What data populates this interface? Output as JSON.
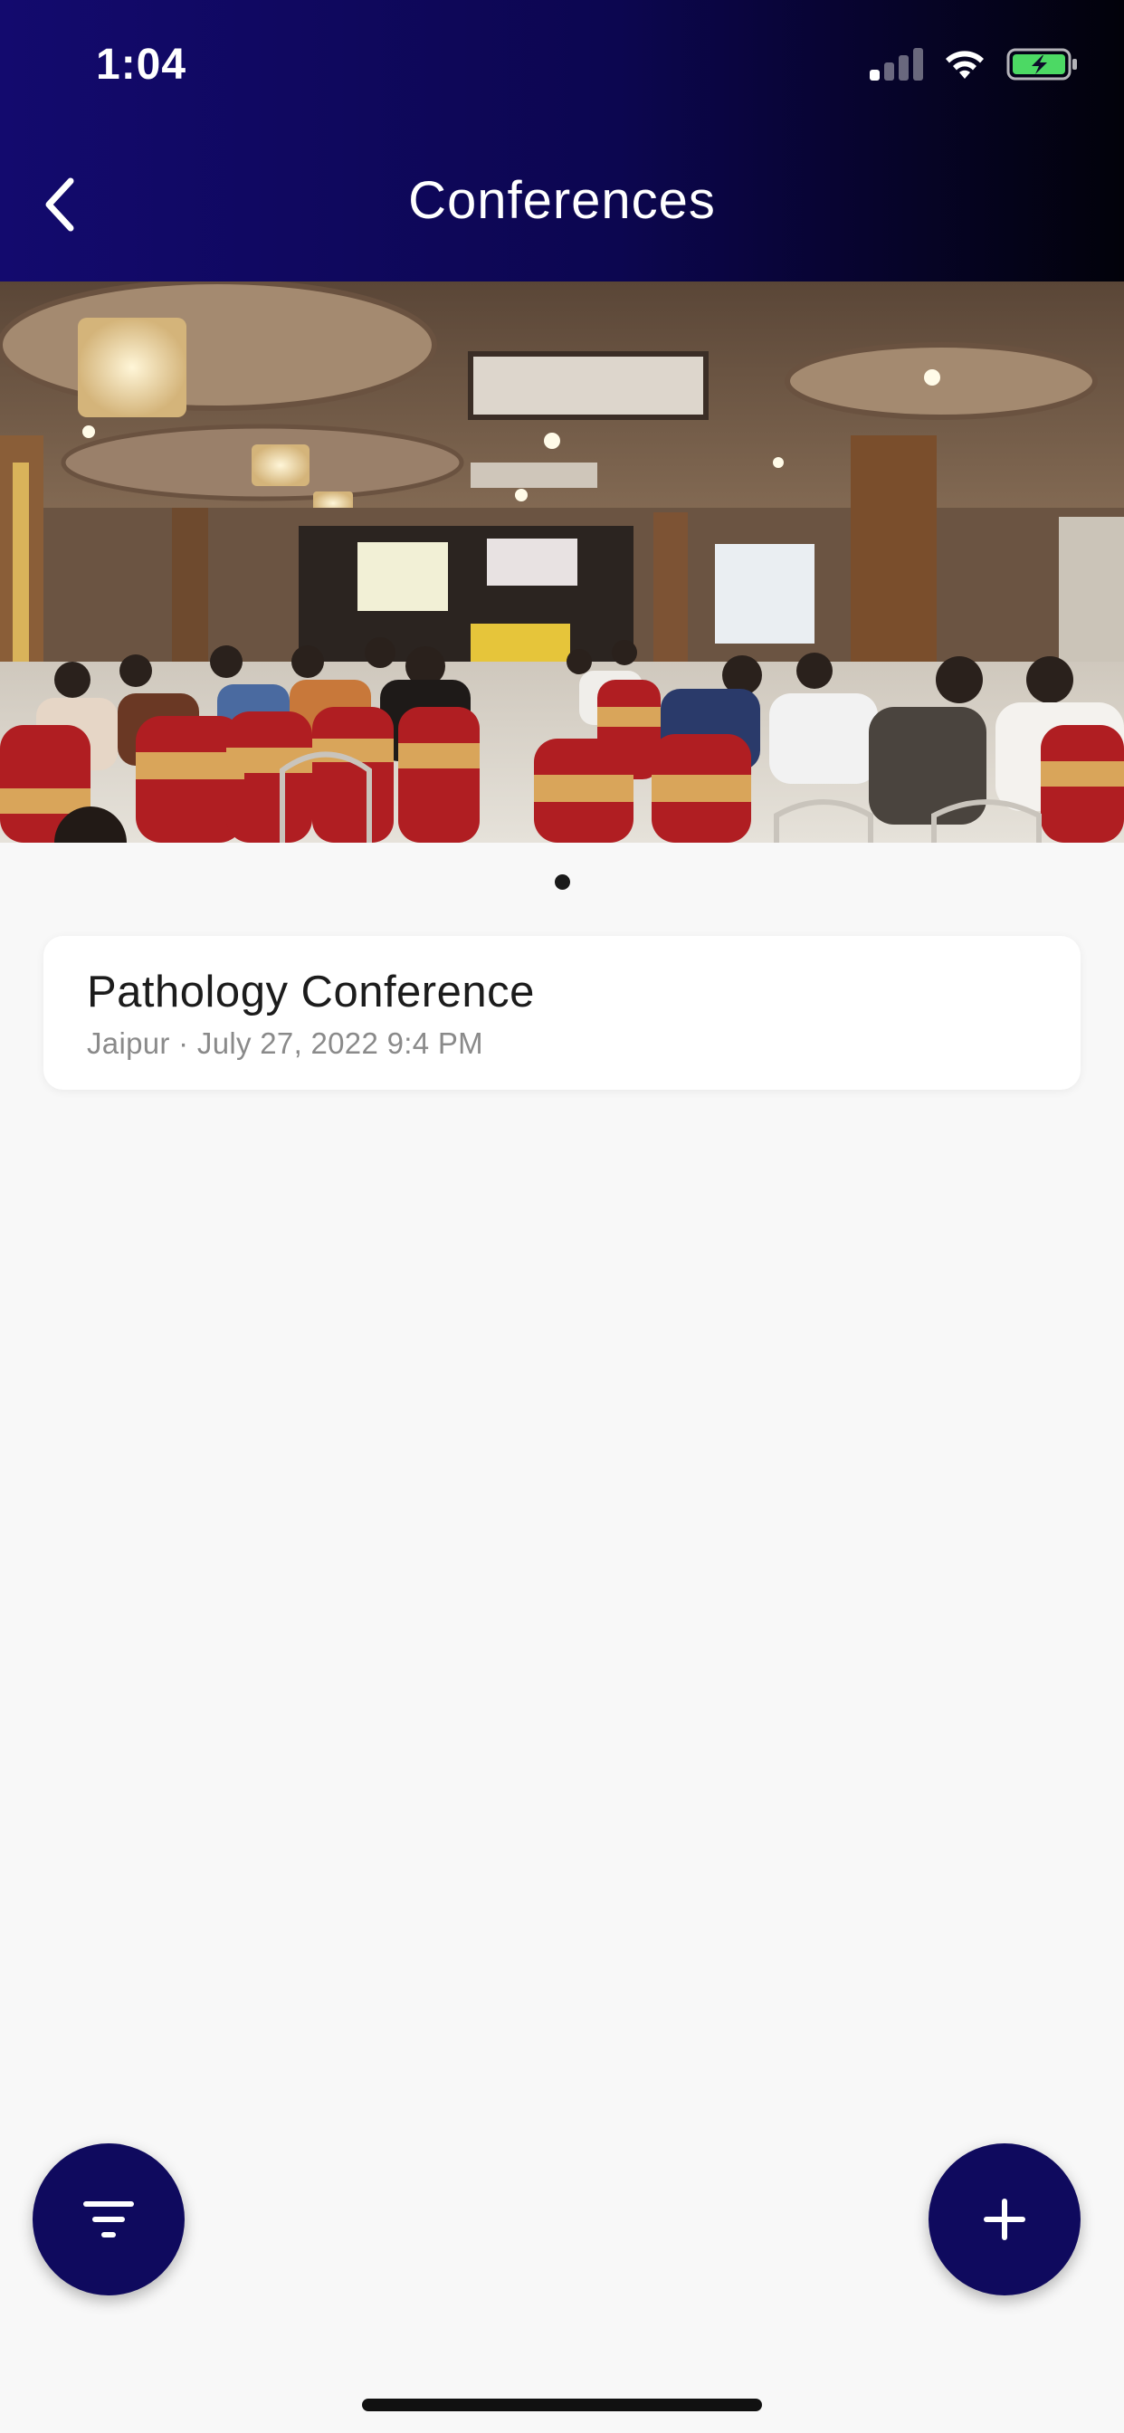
{
  "status_bar": {
    "time": "1:04",
    "icons": [
      "cellular-signal-icon",
      "wifi-icon",
      "battery-charging-icon"
    ],
    "battery_color": "#4cd964"
  },
  "header": {
    "title": "Conferences",
    "back_icon": "chevron-left-icon",
    "gradient_colors": [
      "#130a6e",
      "#02020a"
    ]
  },
  "carousel": {
    "image_description_icon": "conference-hall-photo",
    "page_count": 1,
    "active_index": 0
  },
  "conferences": [
    {
      "title": "Pathology Conference",
      "subtitle": "Jaipur · July 27, 2022 9:4 PM"
    }
  ],
  "fabs": {
    "filter_icon": "filter-icon",
    "add_icon": "plus-icon",
    "color": "#0f0a5e"
  }
}
